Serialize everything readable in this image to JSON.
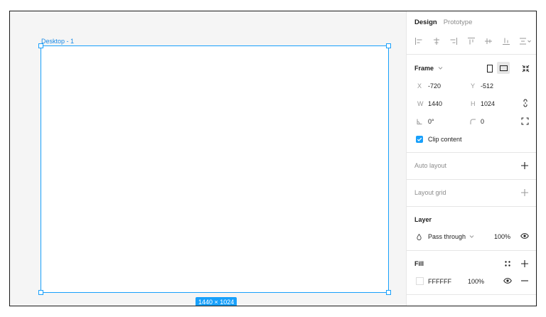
{
  "canvas": {
    "frame_label": "Desktop - 1",
    "size_badge": "1440 × 1024"
  },
  "panel": {
    "tabs": [
      {
        "label": "Design",
        "active": true
      },
      {
        "label": "Prototype",
        "active": false
      }
    ],
    "frame": {
      "title": "Frame",
      "x_label": "X",
      "x_value": "-720",
      "y_label": "Y",
      "y_value": "-512",
      "w_label": "W",
      "w_value": "1440",
      "h_label": "H",
      "h_value": "1024",
      "rotation_value": "0°",
      "radius_value": "0",
      "clip_content": {
        "label": "Clip content",
        "checked": true
      }
    },
    "auto_layout": {
      "title": "Auto layout"
    },
    "layout_grid": {
      "title": "Layout grid"
    },
    "layer": {
      "title": "Layer",
      "blend_mode": "Pass through",
      "opacity": "100%"
    },
    "fill": {
      "title": "Fill",
      "hex": "FFFFFF",
      "opacity": "100%"
    }
  },
  "colors": {
    "accent": "#18a0fb",
    "fill_swatch": "#FFFFFF"
  }
}
